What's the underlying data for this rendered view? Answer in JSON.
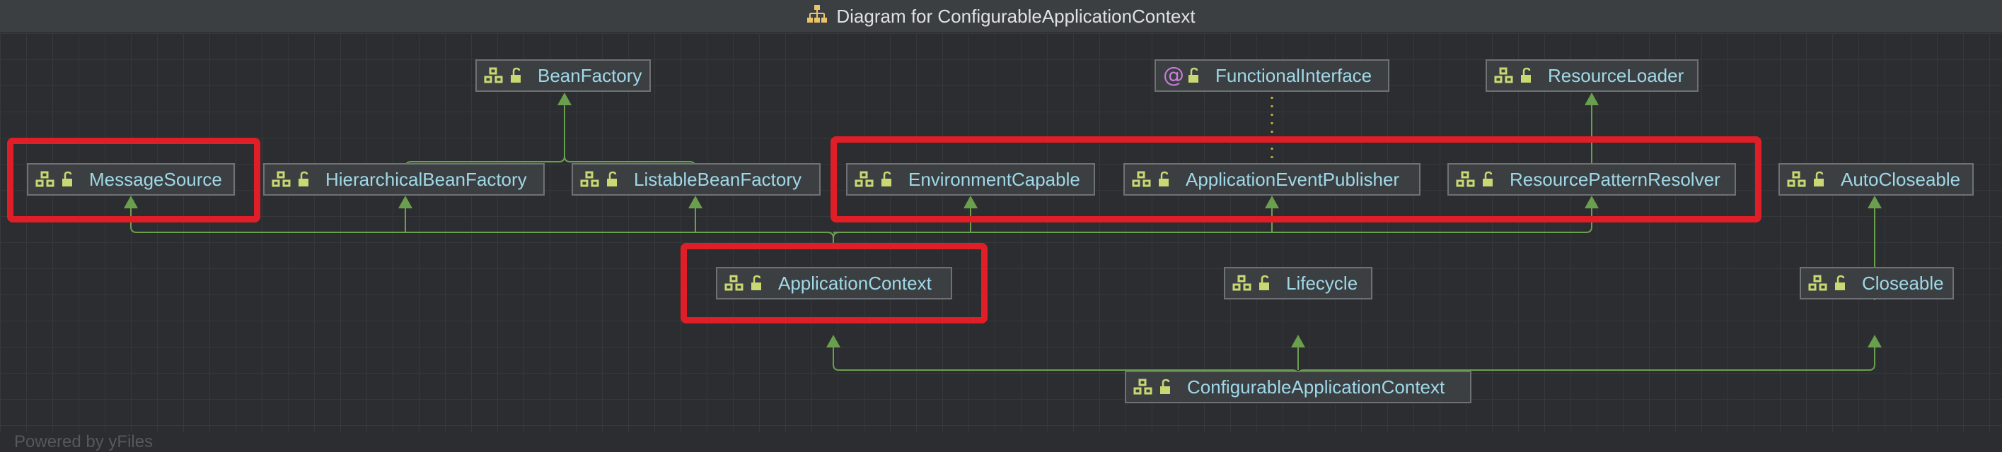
{
  "window": {
    "title": "Diagram for ConfigurableApplicationContext"
  },
  "nodes": {
    "bean_factory": "BeanFactory",
    "functional_interface": "FunctionalInterface",
    "resource_loader": "ResourceLoader",
    "message_source": "MessageSource",
    "hierarchical_bean_factory": "HierarchicalBeanFactory",
    "listable_bean_factory": "ListableBeanFactory",
    "environment_capable": "EnvironmentCapable",
    "application_event_publisher": "ApplicationEventPublisher",
    "resource_pattern_resolver": "ResourcePatternResolver",
    "auto_closeable": "AutoCloseable",
    "application_context": "ApplicationContext",
    "lifecycle": "Lifecycle",
    "closeable": "Closeable",
    "configurable_application_context": "ConfigurableApplicationContext"
  },
  "icons": {
    "interface": "interface-icon",
    "annotation": "annotation-icon",
    "access": "unlock-icon",
    "title": "hierarchy-icon"
  },
  "colors": {
    "canvas": "#2b2d30",
    "node_text": "#9fd8e8",
    "inheritance_edge": "#6a9f4e",
    "annotation_edge": "#b8b13a",
    "highlight": "#e01e27"
  },
  "watermark": "Powered by yFiles"
}
